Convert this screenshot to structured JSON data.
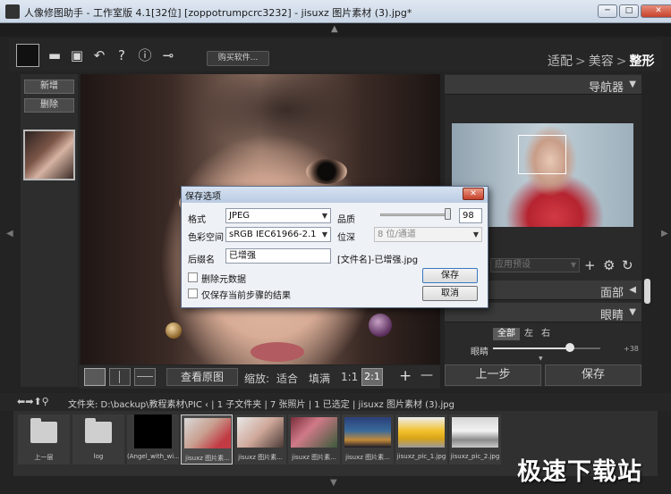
{
  "window": {
    "title": "人像修图助手 - 工作室版 4.1[32位] [zoppotrumpcrc3232] - jisuxz 图片素材 (3).jpg*",
    "controls": {
      "minimize": "─",
      "maximize": "□",
      "close": "✕"
    }
  },
  "toolbar": {
    "icons": [
      "folder-icon",
      "save-icon",
      "undo-icon",
      "help-icon",
      "info-icon",
      "plugin-icon"
    ],
    "glyphs": {
      "folder": "▬",
      "save": "▣",
      "undo": "↶",
      "help": "?",
      "info": "ⓘ",
      "plugin": "⊸"
    },
    "buy_label": "购买软件...",
    "workflow": {
      "step1": "适配",
      "sep": ">",
      "step2": "美容",
      "step3": "整形"
    }
  },
  "left_panel": {
    "new_label": "新增",
    "delete_label": "删除"
  },
  "canvas_bar": {
    "view_original": "查看原图",
    "zoom_label": "缩放:",
    "fit": "适合",
    "fill": "填满",
    "one_to_one": "1:1",
    "two_to_one": "2:1",
    "plus": "+",
    "minus": "—"
  },
  "right_panel": {
    "navigator_label": "导航器",
    "preset_placeholder": "应用预设",
    "face_label": "面部",
    "eyes_label": "眼睛",
    "tabs": {
      "all": "全部",
      "left": "左",
      "right": "右"
    },
    "eye_slider": {
      "label": "眼睛",
      "value": "+38",
      "level": 0.72
    },
    "prev_step": "上一步",
    "save": "保存"
  },
  "path_bar": {
    "text": "文件夹: D:\\backup\\教程素材\\PIC ‹ | 1 子文件夹 | 7 张照片 | 1 已选定 | jisuxz 图片素材 (3).jpg"
  },
  "filmstrip": {
    "items": [
      {
        "label": "上一层"
      },
      {
        "label": "log"
      },
      {
        "label": "(Angel_with_wi..."
      },
      {
        "label": "jisuxz 图片素..."
      },
      {
        "label": "jisuxz 图片素..."
      },
      {
        "label": "jisuxz 图片素..."
      },
      {
        "label": "jisuxz 图片素..."
      },
      {
        "label": "jisuxz_pic_1.jpg"
      },
      {
        "label": "jisuxz_pic_2.jpg"
      }
    ]
  },
  "dialog": {
    "title": "保存选项",
    "close": "✕",
    "format_label": "格式",
    "format_value": "JPEG",
    "quality_label": "品质",
    "quality_value": "98",
    "quality_level": 0.98,
    "colorspace_label": "色彩空间",
    "colorspace_value": "sRGB IEC61966-2.1",
    "bitdepth_label": "位深",
    "bitdepth_value": "8 位/通道",
    "suffix_label": "后缀名",
    "suffix_value": "已增强",
    "filename_preview": "[文件名]-已增强.jpg",
    "strip_metadata_label": "删除元数据",
    "save_current_label": "仅保存当前步骤的结果",
    "save_button": "保存",
    "cancel_button": "取消"
  },
  "watermark": "极速下载站"
}
